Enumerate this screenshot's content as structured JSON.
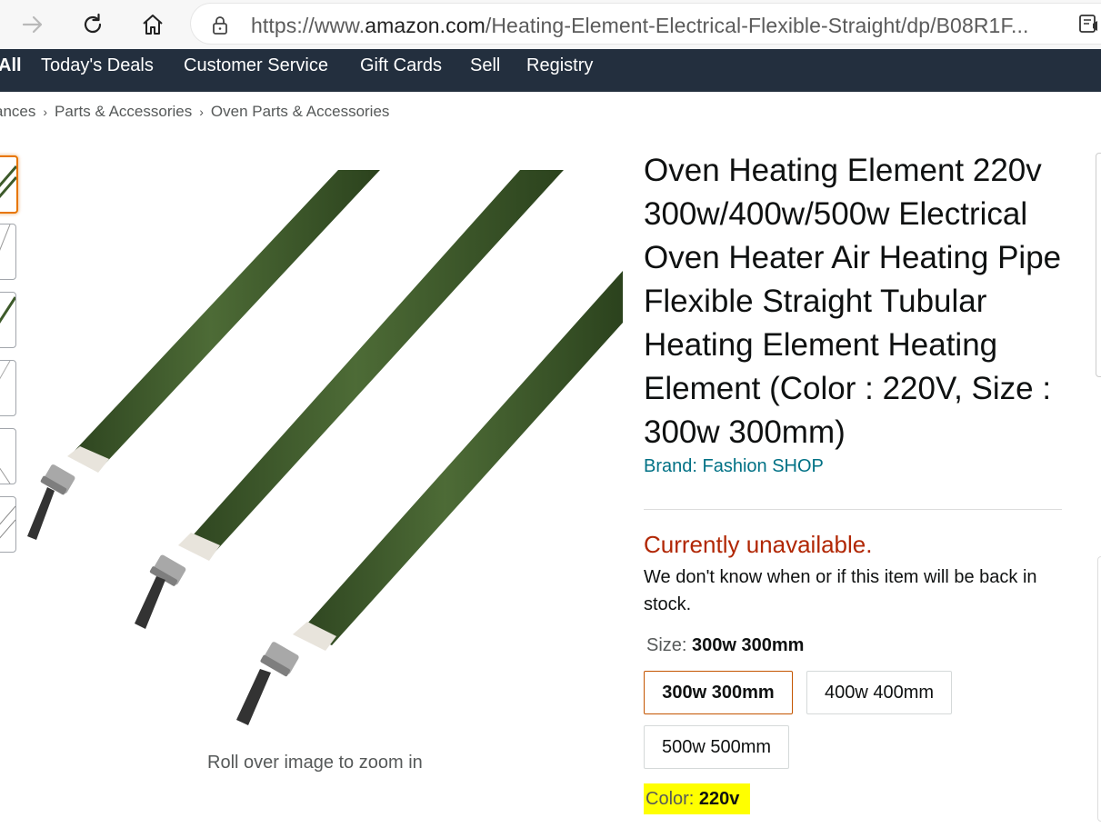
{
  "browser": {
    "url_prefix": "https://www.",
    "url_host": "amazon.com",
    "url_path": "/Heating-Element-Electrical-Flexible-Straight/dp/B08R1F..."
  },
  "nav": {
    "all": "All",
    "items": [
      "Today's Deals",
      "Customer Service",
      "Gift Cards",
      "Sell",
      "Registry"
    ]
  },
  "breadcrumb": [
    "ances",
    "Parts & Accessories",
    "Oven Parts & Accessories"
  ],
  "product": {
    "title": "Oven Heating Element 220v 300w/400w/500w Electrical Oven Heater Air Heating Pipe Flexible Straight Tubular Heating Element Heating Element (Color : 220V, Size : 300w 300mm)",
    "brand": "Brand: Fashion SHOP",
    "availability": "Currently unavailable.",
    "availability_note": "We don't know when or if this item will be back in stock.",
    "size_label": "Size:",
    "size_value": "300w 300mm",
    "sizes": [
      "300w 300mm",
      "400w 400mm",
      "500w 500mm"
    ],
    "selected_size_index": 0,
    "color_label": "Color:",
    "color_value": "220v",
    "zoom_hint": "Roll over image to zoom in"
  },
  "colors": {
    "nav_bg": "#232f3e",
    "link": "#007185",
    "unavailable": "#b12704",
    "highlight": "#ffff00",
    "tube_green": "#3d5a2a",
    "selected_border": "#c45500"
  },
  "icons": [
    "forward-arrow-icon",
    "refresh-icon",
    "home-icon",
    "lock-icon",
    "reader-mode-icon"
  ]
}
